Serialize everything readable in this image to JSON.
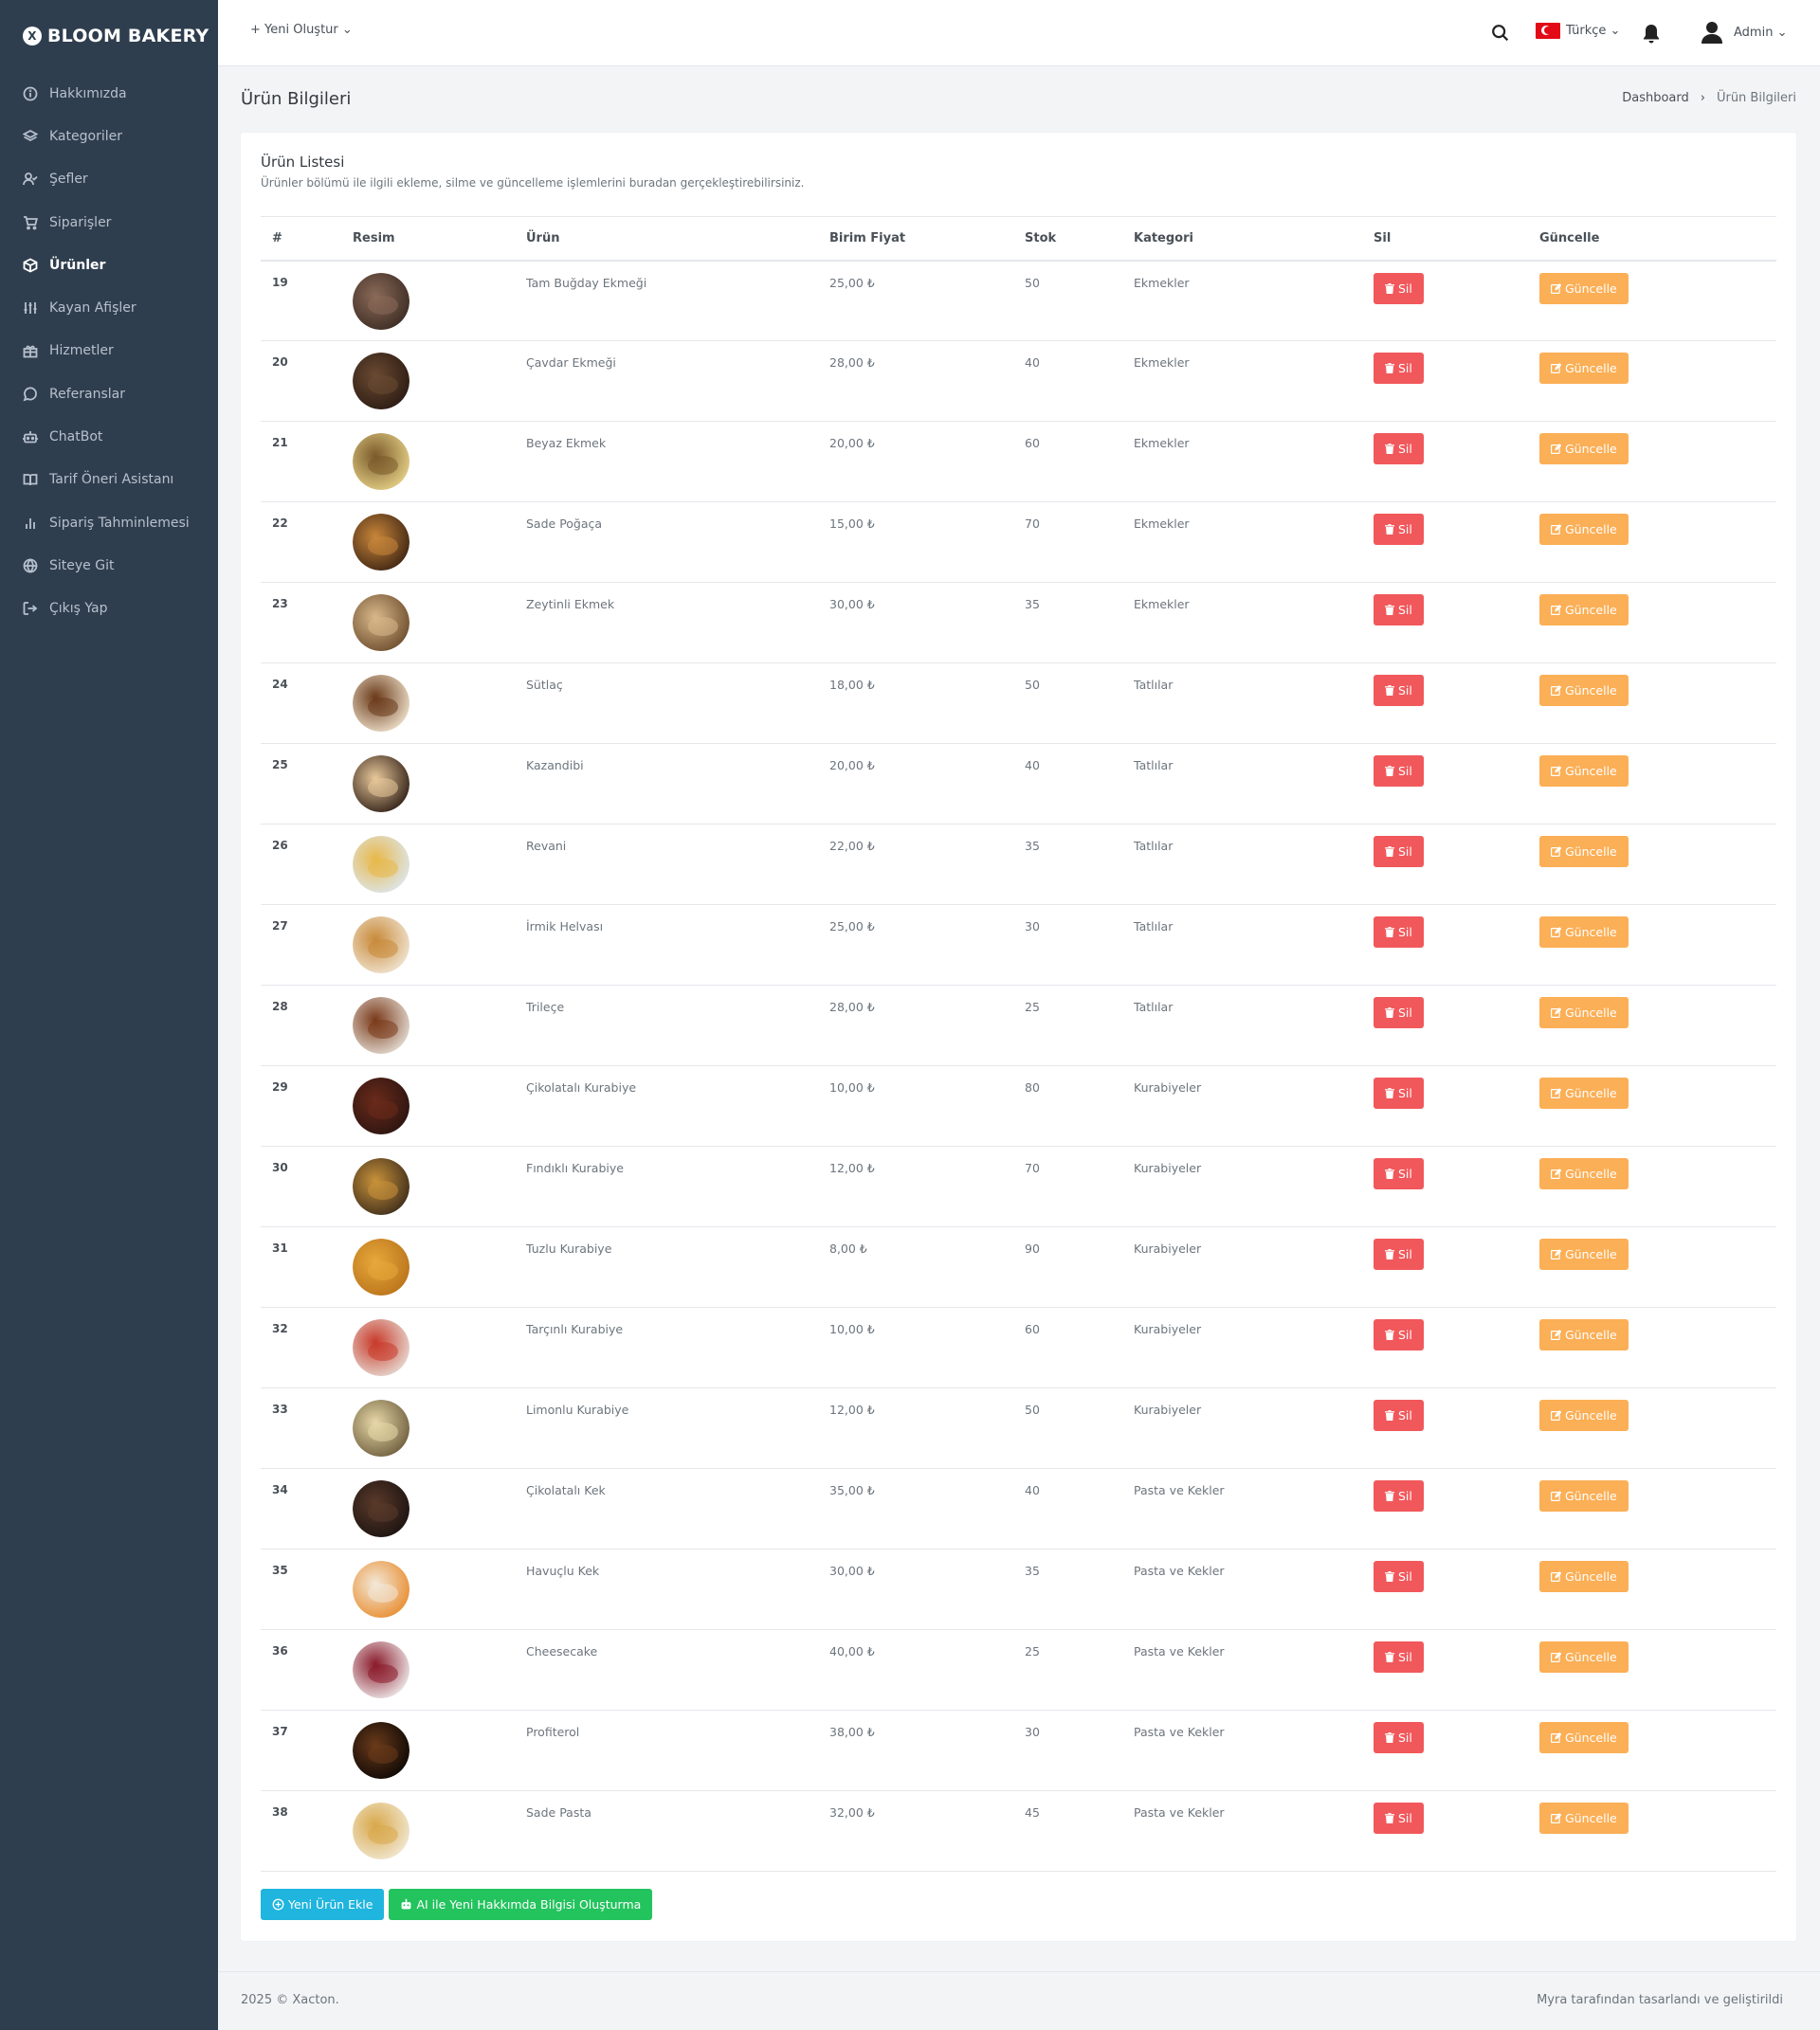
{
  "sidebar": {
    "brand": "BLOOM BAKERY",
    "brand_logo": "X",
    "items": [
      {
        "label": "Hakkımızda",
        "icon": "info-icon"
      },
      {
        "label": "Kategoriler",
        "icon": "layers-icon"
      },
      {
        "label": "Şefler",
        "icon": "user-check-icon"
      },
      {
        "label": "Siparişler",
        "icon": "cart-icon"
      },
      {
        "label": "Ürünler",
        "icon": "box-icon"
      },
      {
        "label": "Kayan Afişler",
        "icon": "sliders-icon"
      },
      {
        "label": "Hizmetler",
        "icon": "gift-icon"
      },
      {
        "label": "Referanslar",
        "icon": "message-circle-icon"
      },
      {
        "label": "ChatBot",
        "icon": "robot-icon"
      },
      {
        "label": "Tarif Öneri Asistanı",
        "icon": "book-open-icon"
      },
      {
        "label": "Sipariş Tahminlemesi",
        "icon": "bar-chart-icon"
      },
      {
        "label": "Siteye Git",
        "icon": "globe-icon"
      },
      {
        "label": "Çıkış Yap",
        "icon": "logout-icon"
      }
    ],
    "active_index": 4
  },
  "topbar": {
    "create_new": "+ Yeni Oluştur ⌄",
    "language": "Türkçe ⌄",
    "user": "Admin ⌄"
  },
  "page": {
    "title": "Ürün Bilgileri",
    "breadcrumb_home": "Dashboard",
    "breadcrumb_sep": "›",
    "breadcrumb_current": "Ürün Bilgileri"
  },
  "card": {
    "title": "Ürün Listesi",
    "subtitle": "Ürünler bölümü ile ilgili ekleme, silme ve güncelleme işlemlerini buradan gerçekleştirebilirsiniz."
  },
  "table": {
    "headers": [
      "#",
      "Resim",
      "Ürün",
      "Birim Fiyat",
      "Stok",
      "Kategori",
      "Sil",
      "Güncelle"
    ],
    "delete_label": "Sil",
    "update_label": "Güncelle",
    "rows": [
      {
        "id": "19",
        "name": "Tam Buğday Ekmeği",
        "price": "25,00 ₺",
        "stock": "50",
        "category": "Ekmekler",
        "c1": "#3a2a22",
        "c2": "#8a6a58"
      },
      {
        "id": "20",
        "name": "Çavdar Ekmeği",
        "price": "28,00 ₺",
        "stock": "40",
        "category": "Ekmekler",
        "c1": "#2a1a12",
        "c2": "#6a4a32"
      },
      {
        "id": "21",
        "name": "Beyaz Ekmek",
        "price": "20,00 ₺",
        "stock": "60",
        "category": "Ekmekler",
        "c1": "#e9d48a",
        "c2": "#7a5a2a"
      },
      {
        "id": "22",
        "name": "Sade Poğaça",
        "price": "15,00 ₺",
        "stock": "70",
        "category": "Ekmekler",
        "c1": "#3a2212",
        "c2": "#c8863a"
      },
      {
        "id": "23",
        "name": "Zeytinli Ekmek",
        "price": "30,00 ₺",
        "stock": "35",
        "category": "Ekmekler",
        "c1": "#6a4a2a",
        "c2": "#d8b88a"
      },
      {
        "id": "24",
        "name": "Sütlaç",
        "price": "18,00 ₺",
        "stock": "50",
        "category": "Tatlılar",
        "c1": "#f2e6d0",
        "c2": "#6a3a1a"
      },
      {
        "id": "25",
        "name": "Kazandibi",
        "price": "20,00 ₺",
        "stock": "40",
        "category": "Tatlılar",
        "c1": "#2a1a12",
        "c2": "#e8c89a"
      },
      {
        "id": "26",
        "name": "Revani",
        "price": "22,00 ₺",
        "stock": "35",
        "category": "Tatlılar",
        "c1": "#dce8f2",
        "c2": "#e8b84a"
      },
      {
        "id": "27",
        "name": "İrmik Helvası",
        "price": "25,00 ₺",
        "stock": "30",
        "category": "Tatlılar",
        "c1": "#f2e8d8",
        "c2": "#c88a3a"
      },
      {
        "id": "28",
        "name": "Trileçe",
        "price": "28,00 ₺",
        "stock": "25",
        "category": "Tatlılar",
        "c1": "#e8e2da",
        "c2": "#7a3a1a"
      },
      {
        "id": "29",
        "name": "Çikolatalı Kurabiye",
        "price": "10,00 ₺",
        "stock": "80",
        "category": "Kurabiyeler",
        "c1": "#2a1410",
        "c2": "#6a2a1a"
      },
      {
        "id": "30",
        "name": "Fındıklı Kurabiye",
        "price": "12,00 ₺",
        "stock": "70",
        "category": "Kurabiyeler",
        "c1": "#3a2a1a",
        "c2": "#c8923a"
      },
      {
        "id": "31",
        "name": "Tuzlu Kurabiye",
        "price": "8,00 ₺",
        "stock": "90",
        "category": "Kurabiyeler",
        "c1": "#b8721a",
        "c2": "#e8a83a"
      },
      {
        "id": "32",
        "name": "Tarçınlı Kurabiye",
        "price": "10,00 ₺",
        "stock": "60",
        "category": "Kurabiyeler",
        "c1": "#e8e0d8",
        "c2": "#c83a2a"
      },
      {
        "id": "33",
        "name": "Limonlu Kurabiye",
        "price": "12,00 ₺",
        "stock": "50",
        "category": "Kurabiyeler",
        "c1": "#6a5a3a",
        "c2": "#e8d8a8"
      },
      {
        "id": "34",
        "name": "Çikolatalı Kek",
        "price": "35,00 ₺",
        "stock": "40",
        "category": "Pasta ve Kekler",
        "c1": "#1a1210",
        "c2": "#5a3a2a"
      },
      {
        "id": "35",
        "name": "Havuçlu Kek",
        "price": "30,00 ₺",
        "stock": "35",
        "category": "Pasta ve Kekler",
        "c1": "#e88a2a",
        "c2": "#f2e8d8"
      },
      {
        "id": "36",
        "name": "Cheesecake",
        "price": "40,00 ₺",
        "stock": "25",
        "category": "Pasta ve Kekler",
        "c1": "#f2f2f2",
        "c2": "#8a1a2a"
      },
      {
        "id": "37",
        "name": "Profiterol",
        "price": "38,00 ₺",
        "stock": "30",
        "category": "Pasta ve Kekler",
        "c1": "#0a0604",
        "c2": "#6a3a1a"
      },
      {
        "id": "38",
        "name": "Sade Pasta",
        "price": "32,00 ₺",
        "stock": "45",
        "category": "Pasta ve Kekler",
        "c1": "#f2ead8",
        "c2": "#d8a84a"
      }
    ]
  },
  "actions": {
    "add_product": "Yeni Ürün Ekle",
    "ai_create": "AI ile Yeni Hakkımda Bilgisi Oluşturma"
  },
  "footer": {
    "left": "2025 © Xacton.",
    "right": "Myra tarafından tasarlandı ve geliştirildi"
  },
  "colors": {
    "sidebar_bg": "#2f3e4e",
    "delete": "#f1585b",
    "update": "#fbaf56",
    "add": "#1fb5de",
    "ai": "#23c35e"
  }
}
